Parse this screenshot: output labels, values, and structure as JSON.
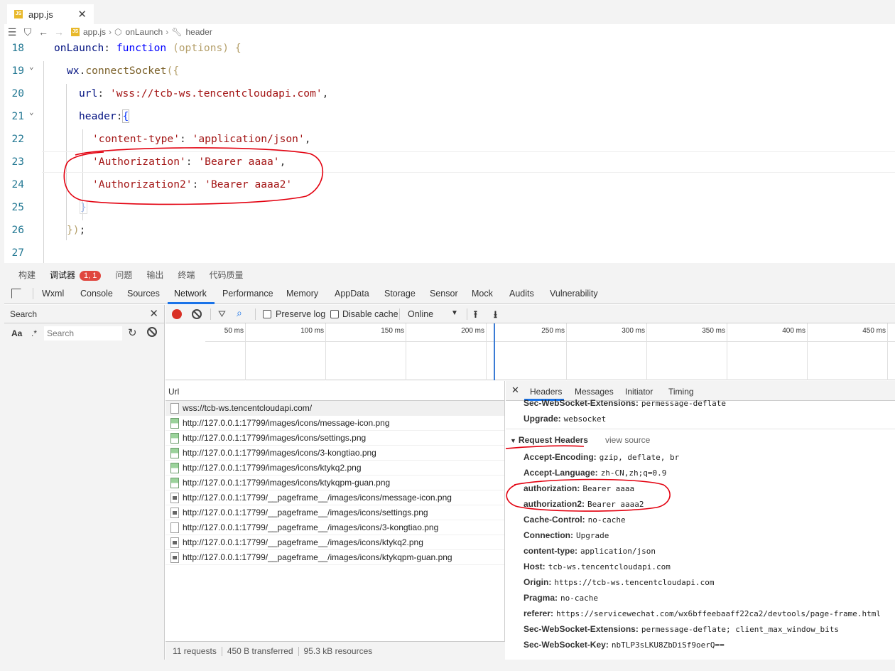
{
  "editor": {
    "tab": {
      "label": "app.js",
      "badge": "JS"
    },
    "breadcrumb": [
      "app.js",
      "onLaunch",
      "header"
    ],
    "lines": [
      {
        "num": "18",
        "text": "onLaunch: function (options) {"
      },
      {
        "num": "19",
        "text": "wx.connectSocket({"
      },
      {
        "num": "20",
        "text": "url: 'wss://tcb-ws.tencentcloudapi.com',"
      },
      {
        "num": "21",
        "text": "header:{"
      },
      {
        "num": "22",
        "text": "'content-type': 'application/json',"
      },
      {
        "num": "23",
        "text": "'Authorization': 'Bearer aaaa',"
      },
      {
        "num": "24",
        "text": "'Authorization2': 'Bearer aaaa2'"
      },
      {
        "num": "25",
        "text": "}"
      },
      {
        "num": "26",
        "text": "});"
      },
      {
        "num": "27",
        "text": ""
      }
    ],
    "tokens": {
      "l18_a": "onLaunch",
      "l18_b": ":",
      "l18_c": "function",
      "l18_d": "(options)",
      "l18_e": "{",
      "l19_a": "wx",
      "l19_b": ".",
      "l19_c": "connectSocket",
      "l19_d": "({",
      "l20_a": "url",
      "l20_b": ": ",
      "l20_c": "'wss://tcb-ws.tencentcloudapi.com'",
      "l20_d": ",",
      "l21_a": "header",
      "l21_b": ":",
      "l21_c": "{",
      "l22_a": "'content-type'",
      "l22_b": ": ",
      "l22_c": "'application/json'",
      "l22_d": ",",
      "l23_a": "'Authorization'",
      "l23_b": ": ",
      "l23_c": "'Bearer aaaa'",
      "l23_d": ",",
      "l24_a": "'Authorization2'",
      "l24_b": ": ",
      "l24_c": "'Bearer aaaa2'",
      "l25_a": "}",
      "l26_a": "})",
      "l26_b": ";"
    }
  },
  "panel": {
    "top_tabs": [
      "构建",
      "调试器",
      "问题",
      "输出",
      "终端",
      "代码质量"
    ],
    "debugger_badge": "1, 1",
    "devtools_tabs": [
      "Wxml",
      "Console",
      "Sources",
      "Network",
      "Performance",
      "Memory",
      "AppData",
      "Storage",
      "Sensor",
      "Mock",
      "Audits",
      "Vulnerability"
    ],
    "active_devtools_tab": "Network"
  },
  "search": {
    "title": "Search",
    "case_label": "Aa",
    "regex_label": ".*",
    "placeholder": "Search"
  },
  "network": {
    "toolbar": {
      "preserve_log": "Preserve log",
      "disable_cache": "Disable cache",
      "throttle": "Online"
    },
    "timeline_ticks": [
      "50 ms",
      "100 ms",
      "150 ms",
      "200 ms",
      "250 ms",
      "300 ms",
      "350 ms",
      "400 ms",
      "450 ms"
    ],
    "list_header": "Url",
    "requests": [
      "wss://tcb-ws.tencentcloudapi.com/",
      "http://127.0.0.1:17799/images/icons/message-icon.png",
      "http://127.0.0.1:17799/images/icons/settings.png",
      "http://127.0.0.1:17799/images/icons/3-kongtiao.png",
      "http://127.0.0.1:17799/images/icons/ktykq2.png",
      "http://127.0.0.1:17799/images/icons/ktykqpm-guan.png",
      "http://127.0.0.1:17799/__pageframe__/images/icons/message-icon.png",
      "http://127.0.0.1:17799/__pageframe__/images/icons/settings.png",
      "http://127.0.0.1:17799/__pageframe__/images/icons/3-kongtiao.png",
      "http://127.0.0.1:17799/__pageframe__/images/icons/ktykq2.png",
      "http://127.0.0.1:17799/__pageframe__/images/icons/ktykqpm-guan.png"
    ],
    "summary": {
      "requests": "11 requests",
      "transferred": "450 B transferred",
      "resources": "95.3 kB resources"
    }
  },
  "detail": {
    "tabs": [
      "Headers",
      "Messages",
      "Initiator",
      "Timing"
    ],
    "response_tail": [
      {
        "name": "Sec-WebSocket-Extensions:",
        "value": "permessage-deflate"
      },
      {
        "name": "Upgrade:",
        "value": "websocket"
      }
    ],
    "request_section": "Request Headers",
    "view_source": "view source",
    "request_headers": [
      {
        "name": "Accept-Encoding:",
        "value": "gzip, deflate, br"
      },
      {
        "name": "Accept-Language:",
        "value": "zh-CN,zh;q=0.9"
      },
      {
        "name": "authorization:",
        "value": "Bearer aaaa"
      },
      {
        "name": "authorization2:",
        "value": "Bearer aaaa2"
      },
      {
        "name": "Cache-Control:",
        "value": "no-cache"
      },
      {
        "name": "Connection:",
        "value": "Upgrade"
      },
      {
        "name": "content-type:",
        "value": "application/json"
      },
      {
        "name": "Host:",
        "value": "tcb-ws.tencentcloudapi.com"
      },
      {
        "name": "Origin:",
        "value": "https://tcb-ws.tencentcloudapi.com"
      },
      {
        "name": "Pragma:",
        "value": "no-cache"
      },
      {
        "name": "referer:",
        "value": "https://servicewechat.com/wx6bffeebaaff22ca2/devtools/page-frame.html"
      },
      {
        "name": "Sec-WebSocket-Extensions:",
        "value": "permessage-deflate; client_max_window_bits"
      },
      {
        "name": "Sec-WebSocket-Key:",
        "value": "nbTLP3sLKU8ZbDiSf9oerQ=="
      }
    ]
  },
  "colors": {
    "annotation": "#e3000f",
    "accent": "#1a73e8",
    "record": "#d93025"
  }
}
